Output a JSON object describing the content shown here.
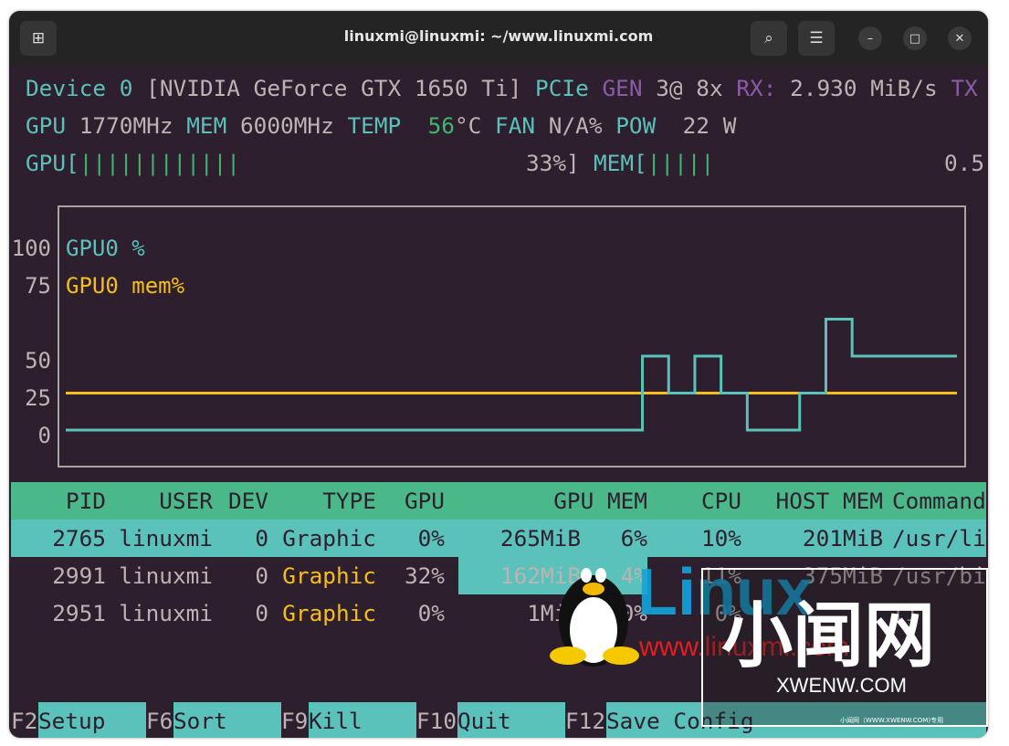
{
  "window": {
    "title": "linuxmi@linuxmi: ~/www.linuxmi.com",
    "icons": [
      "new-tab-icon",
      "search-icon",
      "menu-icon",
      "minimize-icon",
      "maximize-icon",
      "close-icon"
    ]
  },
  "device": {
    "label": "Device",
    "index": "0",
    "name": "[NVIDIA GeForce GTX 1650 Ti]",
    "pcie": "PCIe",
    "gen_label": "GEN",
    "gen": "3@ 8x",
    "rx_label": "RX:",
    "rx": "2.930 MiB/s",
    "tx_label": "TX"
  },
  "stats": {
    "gpu_label": "GPU",
    "gpu_clock": "1770MHz",
    "mem_label": "MEM",
    "mem_clock": "6000MHz",
    "temp_label": "TEMP",
    "temp": "56",
    "temp_unit": "°C",
    "fan_label": "FAN",
    "fan": "N/A%",
    "pow_label": "POW",
    "pow": "22 W"
  },
  "bars": {
    "gpu_label": "GPU[",
    "gpu_ticks": "||||||||||||",
    "gpu_pct": "33%]",
    "gpu_value": 33,
    "mem_label": "MEM[",
    "mem_ticks": "|||||",
    "mem_value": "0.5"
  },
  "chart_data": {
    "type": "line",
    "ylim": [
      0,
      100
    ],
    "yticks": [
      "100",
      "75",
      "50",
      "25",
      "0"
    ],
    "series": [
      {
        "name": "GPU0 %",
        "color": "#5ac1bb",
        "values": [
          0,
          0,
          0,
          0,
          0,
          0,
          0,
          0,
          0,
          0,
          0,
          0,
          0,
          0,
          0,
          0,
          0,
          0,
          0,
          0,
          0,
          0,
          50,
          25,
          50,
          25,
          0,
          0,
          25,
          75,
          50,
          50,
          50,
          50
        ]
      },
      {
        "name": "GPU0 mem%",
        "color": "#f5be1c",
        "values": [
          25,
          25,
          25,
          25,
          25,
          25,
          25,
          25,
          25,
          25,
          25,
          25,
          25,
          25,
          25,
          25,
          25,
          25,
          25,
          25,
          25,
          25,
          25,
          25,
          25,
          25,
          25,
          25,
          25,
          25,
          25,
          25,
          25,
          25
        ]
      }
    ]
  },
  "table": {
    "headers": [
      "PID",
      "USER",
      "DEV",
      "TYPE",
      "GPU",
      "GPU MEM",
      "CPU",
      "HOST MEM",
      "Command"
    ],
    "rows": [
      {
        "pid": "2765",
        "user": "linuxmi",
        "dev": "0",
        "type": "Graphic",
        "gpu": "0%",
        "gpumem": "265MiB",
        "gpumem_pct": "6%",
        "cpu": "10%",
        "hostmem": "201MiB",
        "cmd": "/usr/li",
        "selected": true
      },
      {
        "pid": "2991",
        "user": "linuxmi",
        "dev": "0",
        "type": "Graphic",
        "gpu": "32%",
        "gpumem": "162MiB",
        "gpumem_pct": "4%",
        "cpu": "11%",
        "hostmem": "375MiB",
        "cmd": "/usr/bi",
        "selected": false
      },
      {
        "pid": "2951",
        "user": "linuxmi",
        "dev": "0",
        "type": "Graphic",
        "gpu": "0%",
        "gpumem": "1MiB",
        "gpumem_pct": "0%",
        "cpu": "0%",
        "hostmem": "",
        "cmd": "li",
        "selected": false
      }
    ]
  },
  "footer": [
    {
      "key": "F2",
      "label": "Setup"
    },
    {
      "key": "F6",
      "label": "Sort"
    },
    {
      "key": "F9",
      "label": "Kill"
    },
    {
      "key": "F10",
      "label": "Quit"
    },
    {
      "key": "F12",
      "label": "Save Config"
    }
  ],
  "watermark": {
    "brand": "Linux",
    "site": "www.linuxmi.com",
    "cn": "小闻网",
    "domain": "XWENW.COM",
    "small": "小闻网（WWW.XWENW.COM)专用"
  }
}
